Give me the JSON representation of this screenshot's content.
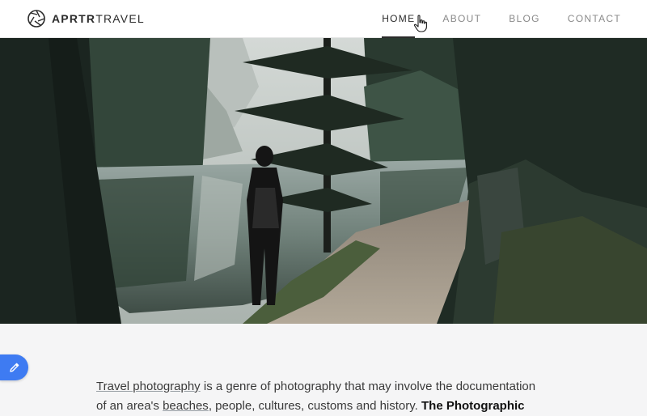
{
  "header": {
    "brand_strong": "APRTR",
    "brand_light": "TRAVEL",
    "logo_icon": "camera-shutter-icon",
    "nav": [
      {
        "label": "HOME",
        "active": true
      },
      {
        "label": "ABOUT",
        "active": false
      },
      {
        "label": "BLOG",
        "active": false
      },
      {
        "label": "CONTACT",
        "active": false
      }
    ]
  },
  "hero": {
    "image": "person standing on lakeside forest path"
  },
  "fab": {
    "icon": "pencil-icon",
    "color": "#3e7bf2"
  },
  "content": {
    "link_text": "Travel photography",
    "line1_rest": " is a genre of photography that may involve the documentation",
    "line2_start": "of an area's ",
    "line2_link": "beaches",
    "line2_mid": ", people, cultures, customs and history. ",
    "line2_bold": "The Photographic"
  },
  "colors": {
    "accent": "#3e7bf2",
    "text": "#2b2b2b",
    "nav_inactive": "#8a8a8a"
  }
}
